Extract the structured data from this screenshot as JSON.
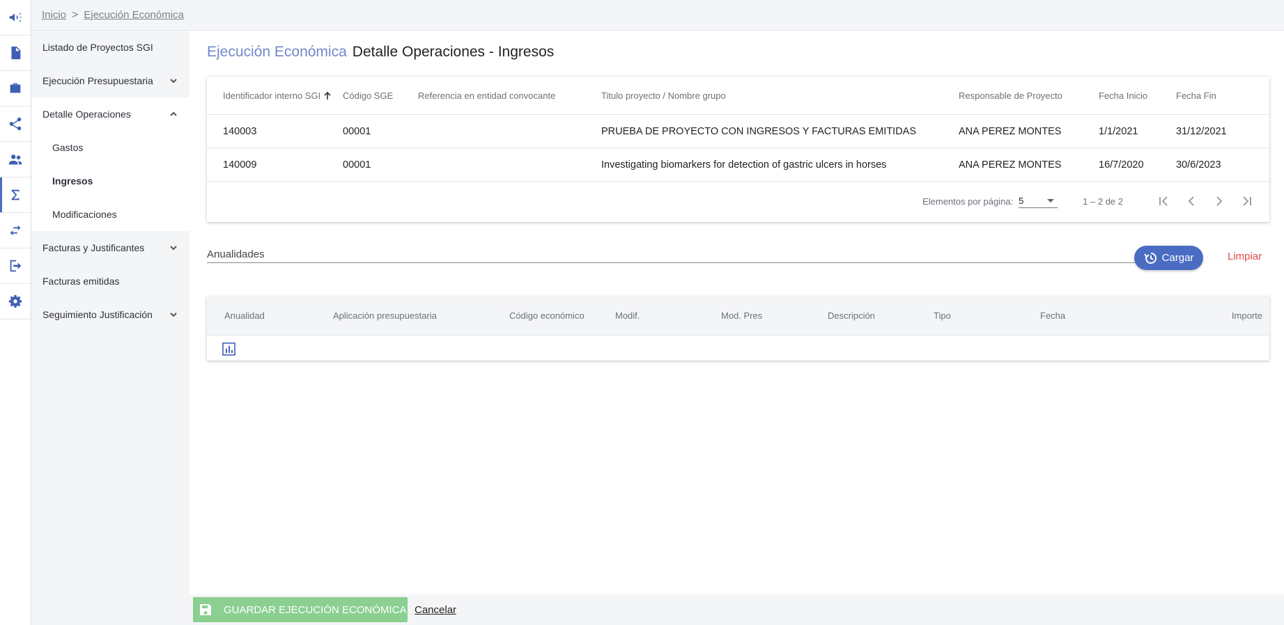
{
  "breadcrumb": {
    "home": "Inicio",
    "separator": ">",
    "current": "Ejecución Económica"
  },
  "rail": [
    {
      "icon": "megaphone-icon"
    },
    {
      "icon": "document-icon"
    },
    {
      "icon": "briefcase-icon"
    },
    {
      "icon": "share-icon"
    },
    {
      "icon": "people-icon"
    },
    {
      "icon": "sigma-icon",
      "active": true
    },
    {
      "icon": "swap-icon"
    },
    {
      "icon": "logout-icon"
    },
    {
      "icon": "settings-icon"
    }
  ],
  "sidemenu": {
    "items": [
      {
        "label": "Listado de Proyectos SGI"
      },
      {
        "label": "Ejecución Presupuestaria"
      },
      {
        "label": "Detalle Operaciones"
      },
      {
        "label": "Gastos"
      },
      {
        "label": "Ingresos"
      },
      {
        "label": "Modificaciones"
      },
      {
        "label": "Facturas y Justificantes"
      },
      {
        "label": "Facturas emitidas"
      },
      {
        "label": "Seguimiento Justificación"
      }
    ]
  },
  "title": {
    "section": "Ejecución Económica",
    "page": "Detalle Operaciones - Ingresos"
  },
  "projects_table": {
    "headers": [
      "Identificador interno SGI",
      "Código SGE",
      "Referencia en entidad convocante",
      "Titulo proyecto / Nombre grupo",
      "Responsable de Proyecto",
      "Fecha Inicio",
      "Fecha Fin"
    ],
    "rows": [
      [
        "140003",
        "00001",
        "",
        "PRUEBA DE PROYECTO CON INGRESOS Y FACTURAS EMITIDAS",
        "ANA PEREZ MONTES",
        "1/1/2021",
        "31/12/2021"
      ],
      [
        "140009",
        "00001",
        "",
        "Investigating biomarkers for detection of gastric ulcers in horses",
        "ANA PEREZ MONTES",
        "16/7/2020",
        "30/6/2023"
      ]
    ],
    "paginator": {
      "label": "Elementos por página:",
      "page_size": "5",
      "range": "1 – 2 de 2"
    }
  },
  "anualidades": {
    "placeholder": "Anualidades",
    "load_label": "Cargar",
    "clear_label": "Limpiar"
  },
  "ingresos_table": {
    "headers": [
      "Anualidad",
      "Aplicación presupuestaria",
      "Código económico",
      "Modif.",
      "Mod. Pres",
      "Descripción",
      "Tipo",
      "Fecha",
      "Importe"
    ]
  },
  "footer": {
    "save_label": "GUARDAR EJECUCIÓN ECONÓMICA",
    "cancel_label": "Cancelar"
  },
  "colors": {
    "accent": "#4a6cc3",
    "danger": "#e04848",
    "save": "#8bcf91",
    "panel": "#f4f5f7"
  }
}
